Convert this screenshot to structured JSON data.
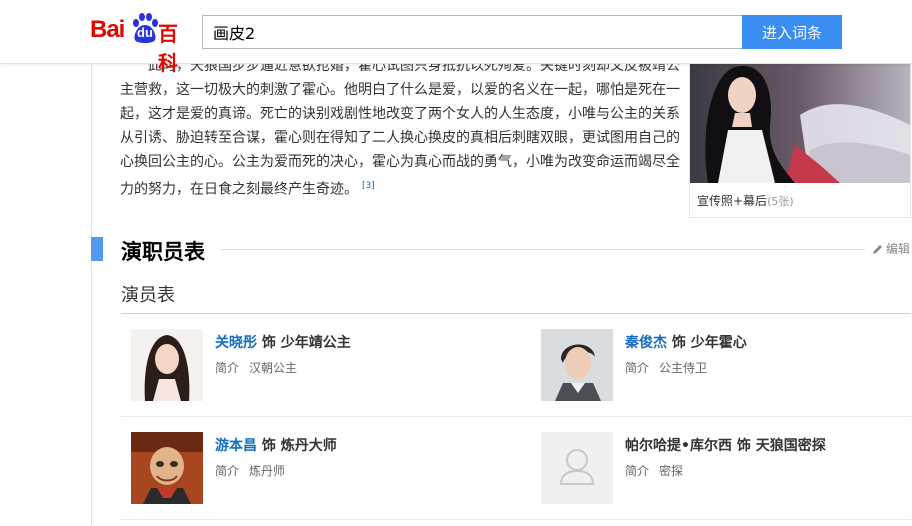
{
  "logo": {
    "bai": "Bai",
    "du": "du",
    "baike": "百科"
  },
  "search": {
    "value": "画皮2",
    "button": "进入词条"
  },
  "paragraph": {
    "text": "此时，天狼国步步逼近意欲抢婚，霍心试图只身抵抗以死殉爱。关键时刻却又反被靖公主营救，这一切极大的刺激了霍心。他明白了什么是爱，以爱的名义在一起，哪怕是死在一起，这才是爱的真谛。死亡的诀别戏剧性地改变了两个女人的人生态度，小唯与公主的关系从引诱、胁迫转至合谋，霍心则在得知了二人换心换皮的真相后刺瞎双眼，更试图用自己的心换回公主的心。公主为爱而死的决心，霍心为真心而战的勇气，小唯为改变命运而竭尽全力的努力，在日食之刻最终产生奇迹。",
    "ref": "[3]"
  },
  "album": {
    "caption": "宣传照+幕后",
    "count": "(5张)"
  },
  "section": {
    "title": "演职员表",
    "edit": "编辑",
    "subtitle": "演员表"
  },
  "cast": [
    {
      "actor": "关晓彤",
      "role": "饰 少年靖公主",
      "intro_label": "简介",
      "intro": "汉朝公主",
      "linked": true
    },
    {
      "actor": "秦俊杰",
      "role": "饰 少年霍心",
      "intro_label": "简介",
      "intro": "公主侍卫",
      "linked": true
    },
    {
      "actor": "游本昌",
      "role": "饰 炼丹大师",
      "intro_label": "简介",
      "intro": "炼丹师",
      "linked": true
    },
    {
      "actor": "帕尔哈提•库尔西",
      "role": "饰 天狼国密探",
      "intro_label": "简介",
      "intro": "密探",
      "linked": false
    }
  ],
  "colors": {
    "brand_red": "#e10601",
    "accent_blue": "#3a8ef2",
    "link_blue": "#136ec2",
    "section_bar": "#4f9cee"
  }
}
